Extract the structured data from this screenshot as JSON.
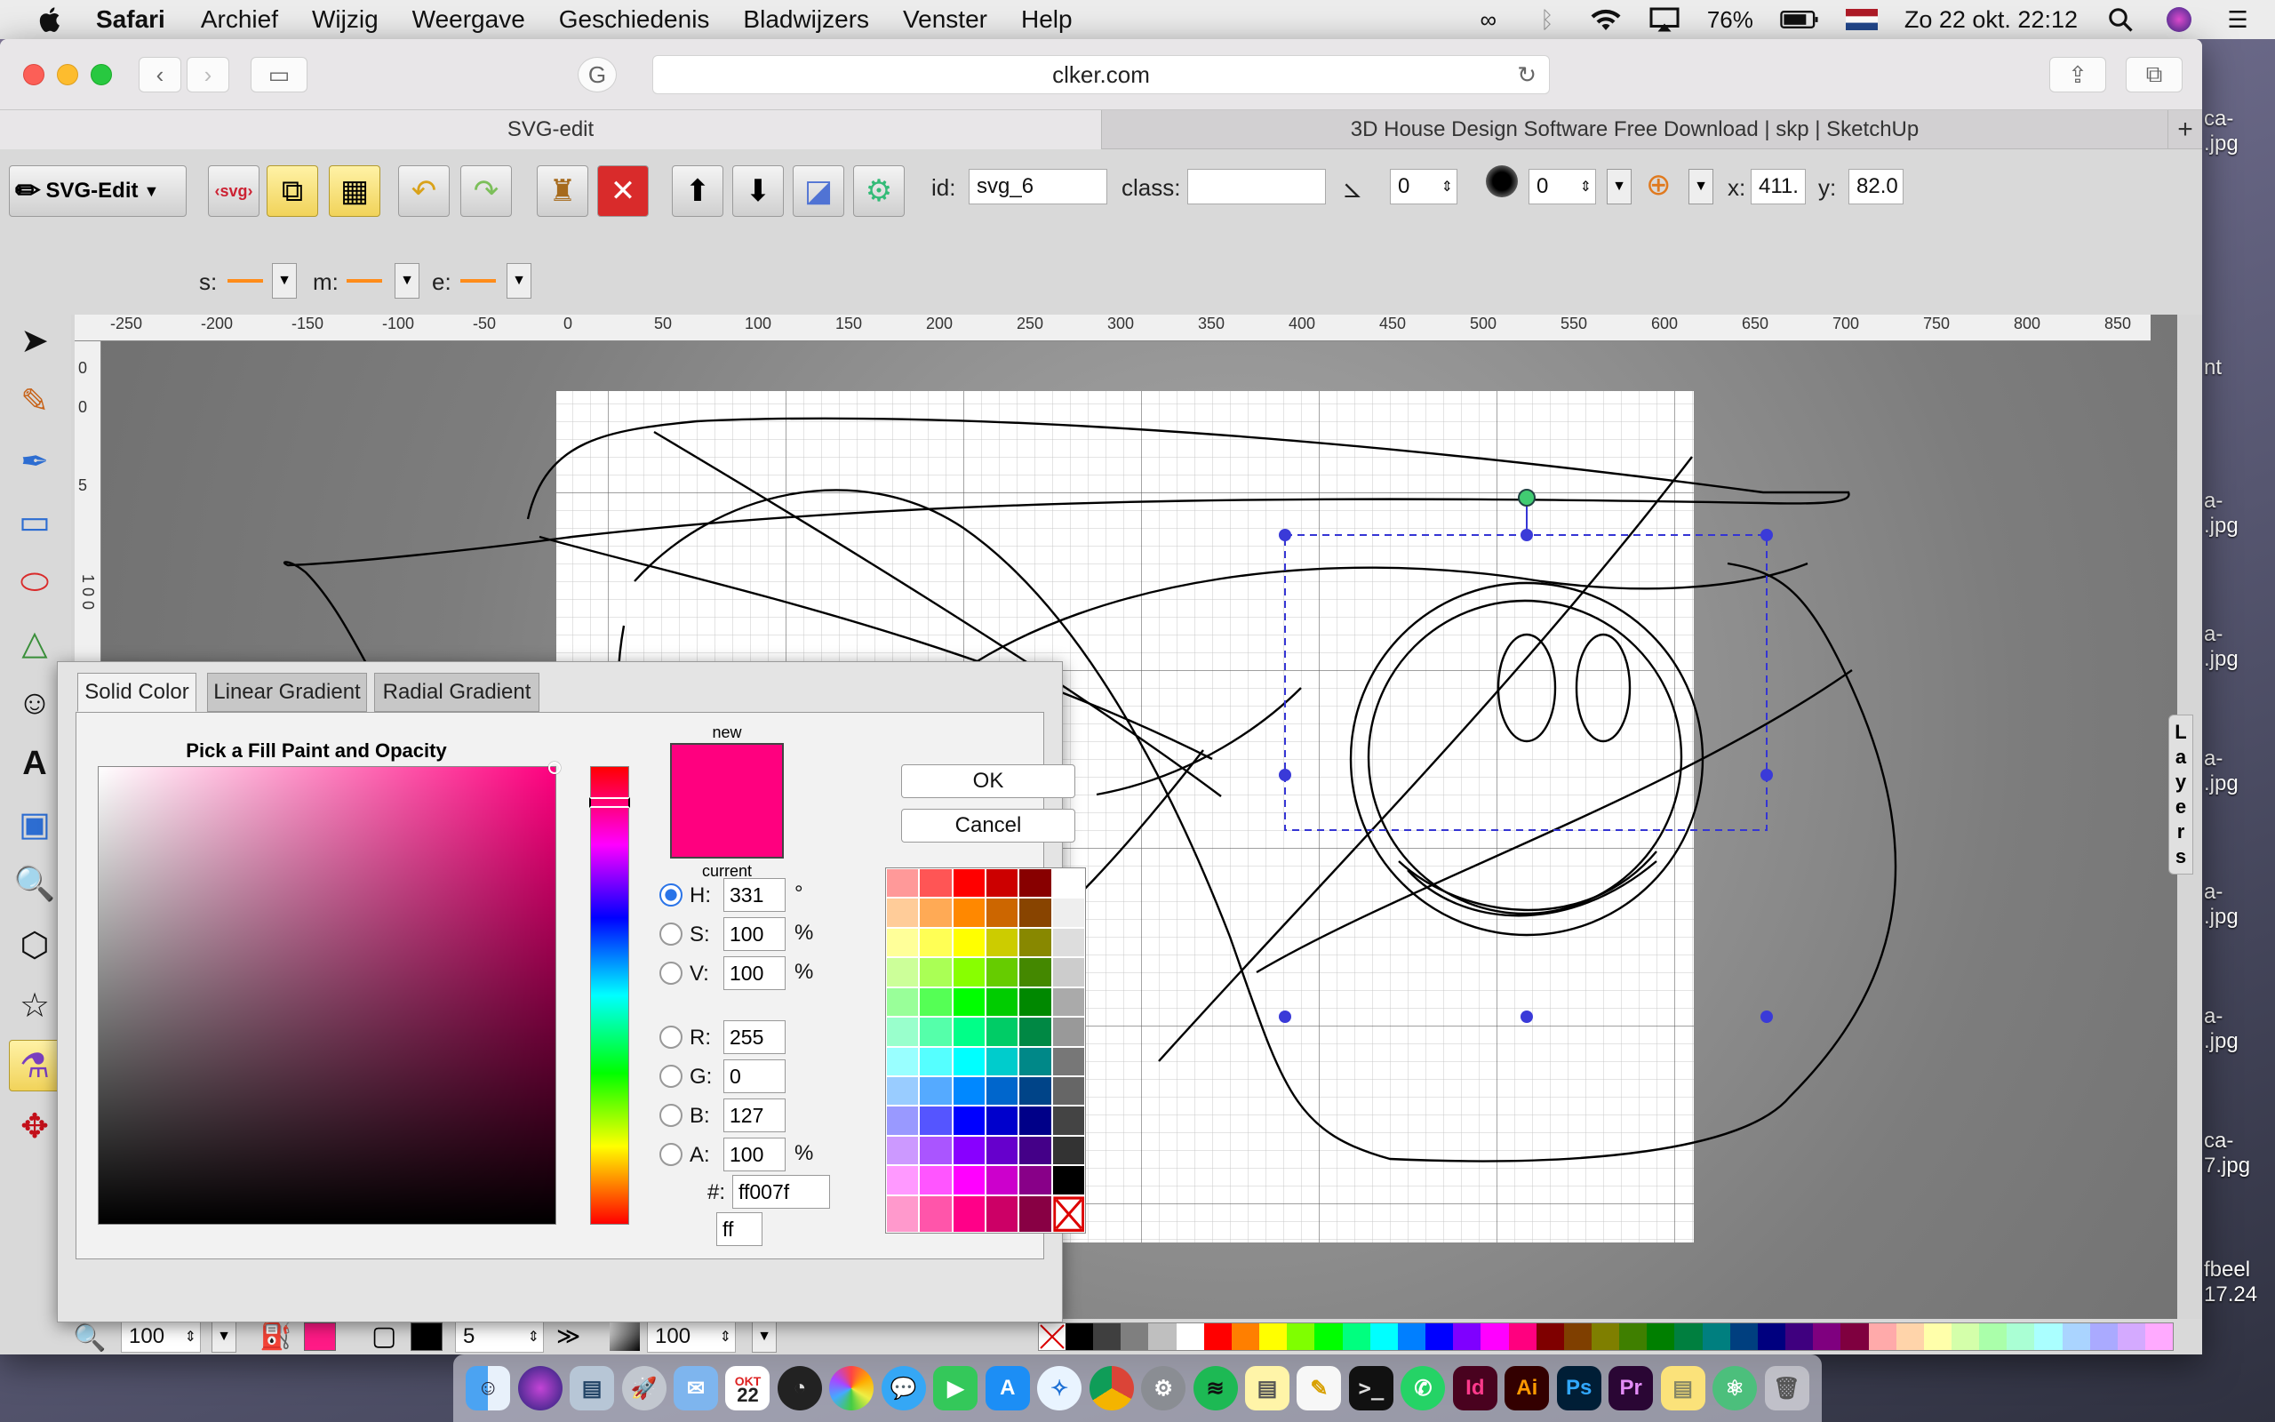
{
  "menubar": {
    "app": "Safari",
    "items": [
      "Archief",
      "Wijzig",
      "Weergave",
      "Geschiedenis",
      "Bladwijzers",
      "Venster",
      "Help"
    ],
    "battery": "76%",
    "datetime": "Zo 22 okt.  22:12"
  },
  "browser": {
    "url": "clker.com",
    "tabs": [
      "SVG-edit",
      "3D House Design Software Free Download | skp | SketchUp"
    ],
    "new_tab": "+"
  },
  "toolbar": {
    "menu_label": "SVG-Edit",
    "id_label": "id:",
    "id_value": "svg_6",
    "class_label": "class:",
    "class_value": "",
    "angle_value": "0",
    "blur_value": "0",
    "x_label": "x:",
    "x_value": "411.",
    "y_label": "y:",
    "y_value": "82.0",
    "markers": {
      "s": "s:",
      "m": "m:",
      "e": "e:"
    }
  },
  "rulers": {
    "h": [
      "-250",
      "-200",
      "-150",
      "-100",
      "-50",
      "0",
      "50",
      "100",
      "150",
      "200",
      "250",
      "300",
      "350",
      "400",
      "450",
      "500",
      "550",
      "600",
      "650",
      "700",
      "750",
      "800",
      "850"
    ],
    "v": [
      "0",
      "5",
      "1 0 0"
    ]
  },
  "layers_tab": [
    "L",
    "a",
    "y",
    "e",
    "r",
    "s"
  ],
  "color_picker": {
    "tabs": [
      "Solid Color",
      "Linear Gradient",
      "Radial Gradient"
    ],
    "active_tab": 0,
    "title": "Pick a Fill Paint and Opacity",
    "new_label": "new",
    "current_label": "current",
    "new_color": "#ff007f",
    "ok": "OK",
    "cancel": "Cancel",
    "fields": {
      "H": {
        "label": "H:",
        "value": "331",
        "unit": "°"
      },
      "S": {
        "label": "S:",
        "value": "100",
        "unit": "%"
      },
      "V": {
        "label": "V:",
        "value": "100",
        "unit": "%"
      },
      "R": {
        "label": "R:",
        "value": "255",
        "unit": ""
      },
      "G": {
        "label": "G:",
        "value": "0",
        "unit": ""
      },
      "B": {
        "label": "B:",
        "value": "127",
        "unit": ""
      },
      "A": {
        "label": "A:",
        "value": "100",
        "unit": "%"
      }
    },
    "hex_label": "#:",
    "hex_value": "ff007f",
    "alpha_hex": "ff",
    "swatches": [
      [
        "#ff9999",
        "#ff5555",
        "#ff0000",
        "#cc0000",
        "#880000",
        "#ffffff"
      ],
      [
        "#ffcc99",
        "#ffaa55",
        "#ff8800",
        "#cc6600",
        "#884400",
        "#eeeeee"
      ],
      [
        "#ffff99",
        "#ffff55",
        "#ffff00",
        "#cccc00",
        "#888800",
        "#dddddd"
      ],
      [
        "#ccff99",
        "#aaff55",
        "#88ff00",
        "#66cc00",
        "#448800",
        "#cccccc"
      ],
      [
        "#99ff99",
        "#55ff55",
        "#00ff00",
        "#00cc00",
        "#008800",
        "#aaaaaa"
      ],
      [
        "#99ffcc",
        "#55ffaa",
        "#00ff88",
        "#00cc66",
        "#008844",
        "#999999"
      ],
      [
        "#99ffff",
        "#55ffff",
        "#00ffff",
        "#00cccc",
        "#008888",
        "#777777"
      ],
      [
        "#99ccff",
        "#55aaff",
        "#0088ff",
        "#0066cc",
        "#004488",
        "#666666"
      ],
      [
        "#9999ff",
        "#5555ff",
        "#0000ff",
        "#0000cc",
        "#000088",
        "#444444"
      ],
      [
        "#cc99ff",
        "#aa55ff",
        "#8800ff",
        "#6600cc",
        "#440088",
        "#333333"
      ],
      [
        "#ff99ff",
        "#ff55ff",
        "#ff00ff",
        "#cc00cc",
        "#880088",
        "#000000"
      ],
      [
        "#ff99cc",
        "#ff55aa",
        "#ff0088",
        "#cc0066",
        "#880044",
        "none"
      ]
    ]
  },
  "bottom": {
    "zoom": "100",
    "stroke_width": "5",
    "opacity": "100",
    "fill_color": "#ff1a86",
    "stroke_color": "#000000",
    "palette": [
      "#000000",
      "#3f3f3f",
      "#7f7f7f",
      "#bfbfbf",
      "#ffffff",
      "#ff0000",
      "#ff7f00",
      "#ffff00",
      "#7fff00",
      "#00ff00",
      "#00ff7f",
      "#00ffff",
      "#007fff",
      "#0000ff",
      "#7f00ff",
      "#ff00ff",
      "#ff007f",
      "#7f0000",
      "#7f3f00",
      "#7f7f00",
      "#3f7f00",
      "#007f00",
      "#007f3f",
      "#007f7f",
      "#003f7f",
      "#00007f",
      "#3f007f",
      "#7f007f",
      "#7f003f",
      "#ffaaaa",
      "#ffd4aa",
      "#ffffaa",
      "#d4ffaa",
      "#aaffaa",
      "#aaffd4",
      "#aaffff",
      "#aad4ff",
      "#aaaaff",
      "#d4aaff",
      "#ffaaff"
    ]
  },
  "desktop_files": [
    "ca-\n.jpg",
    "nt",
    "a-\n.jpg",
    "a-\n.jpg",
    "a-\n.jpg",
    "a-\n.jpg",
    "a-\n.jpg",
    "ca-\n7.jpg",
    "fbeel\n17.24"
  ],
  "dock": [
    "Finder",
    "Siri",
    "Preview",
    "Launchpad",
    "Mail",
    "Agenda",
    "Dashboard",
    "Foto's",
    "Berichten",
    "FaceTime",
    "App Store",
    "Safari",
    "Chrome",
    "Systeemvoorkeuren",
    "Spotify",
    "Notities",
    "Stickies",
    "Terminal",
    "WhatsApp",
    "Id",
    "Ai",
    "Ps",
    "Pr",
    "Stickies2",
    "Atom",
    "Prullenmand"
  ],
  "dock_labels": {
    "id": "Id",
    "ai": "Ai",
    "ps": "Ps",
    "pr": "Pr",
    "cal_month": "OKT",
    "cal_day": "22"
  }
}
